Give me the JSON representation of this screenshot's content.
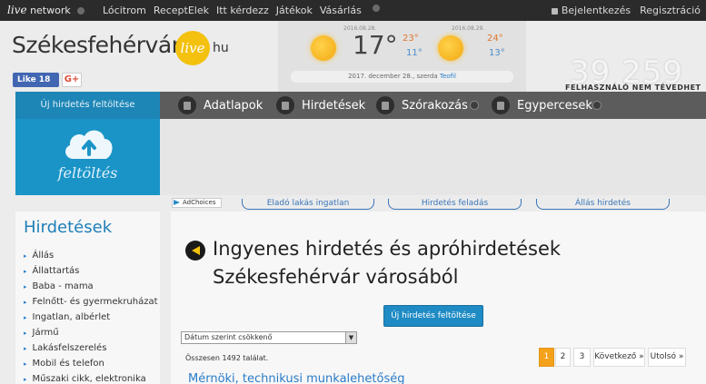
{
  "topbar": {
    "brand_live": "live",
    "brand_network": "network",
    "menu": [
      "Lócitrom",
      "ReceptElek",
      "Itt kérdezz",
      "Játékok",
      "Vásárlás"
    ],
    "login": "Bejelentkezés",
    "register": "Regisztráció"
  },
  "header": {
    "logo_text": "Székesfehérvár",
    "logo_badge": "live",
    "logo_tld": "hu",
    "fb_like": "Like 18",
    "gplus": "G+"
  },
  "weather": {
    "day1_date": "2016.08.28.",
    "day1_temp": "17°",
    "day1_hi": "23°",
    "day1_lo": "11°",
    "day2_date": "2016.08.29.",
    "day2_hi": "24°",
    "day2_lo": "13°",
    "footer_text": "2017. december 28., szerda",
    "footer_name": "Teofil"
  },
  "counter": {
    "value": "39 259",
    "label": "FELHASZNÁLÓ NEM TÉVEDHET"
  },
  "upload": {
    "header": "Új hirdetés feltöltése",
    "label": "feltöltés"
  },
  "nav": {
    "items": [
      "Adatlapok",
      "Hirdetések",
      "Szórakozás",
      "Egypercesek"
    ]
  },
  "sublinks": {
    "adchoices": "AdChoices",
    "links": [
      "Eladó lakás ingatlan",
      "Hirdetés feladás",
      "Állás hirdetés"
    ]
  },
  "sidebar": {
    "title": "Hirdetések",
    "items": [
      "Állás",
      "Állattartás",
      "Baba - mama",
      "Felnőtt- és gyermekruházat",
      "Ingatlan, albérlet",
      "Jármű",
      "Lakásfelszerelés",
      "Mobil és telefon",
      "Műszaki cikk, elektronika"
    ]
  },
  "main": {
    "title": "Ingyenes hirdetés és apróhirdetések Székesfehérvár városából",
    "new_button": "Új hirdetés feltöltése",
    "sort_value": "Dátum szerint csökkenő",
    "count_text": "Összesen 1492 találat.",
    "pager": [
      "1",
      "2",
      "3",
      "Következő »",
      "Utolsó »"
    ],
    "first_listing": "Mérnöki, technikusi munkalehetőség"
  },
  "colors": {
    "accent_blue": "#1f8bc4",
    "nav_gray": "#5c5c5c",
    "active_page": "#f4a21b",
    "logo_badge": "#f3c10e"
  }
}
